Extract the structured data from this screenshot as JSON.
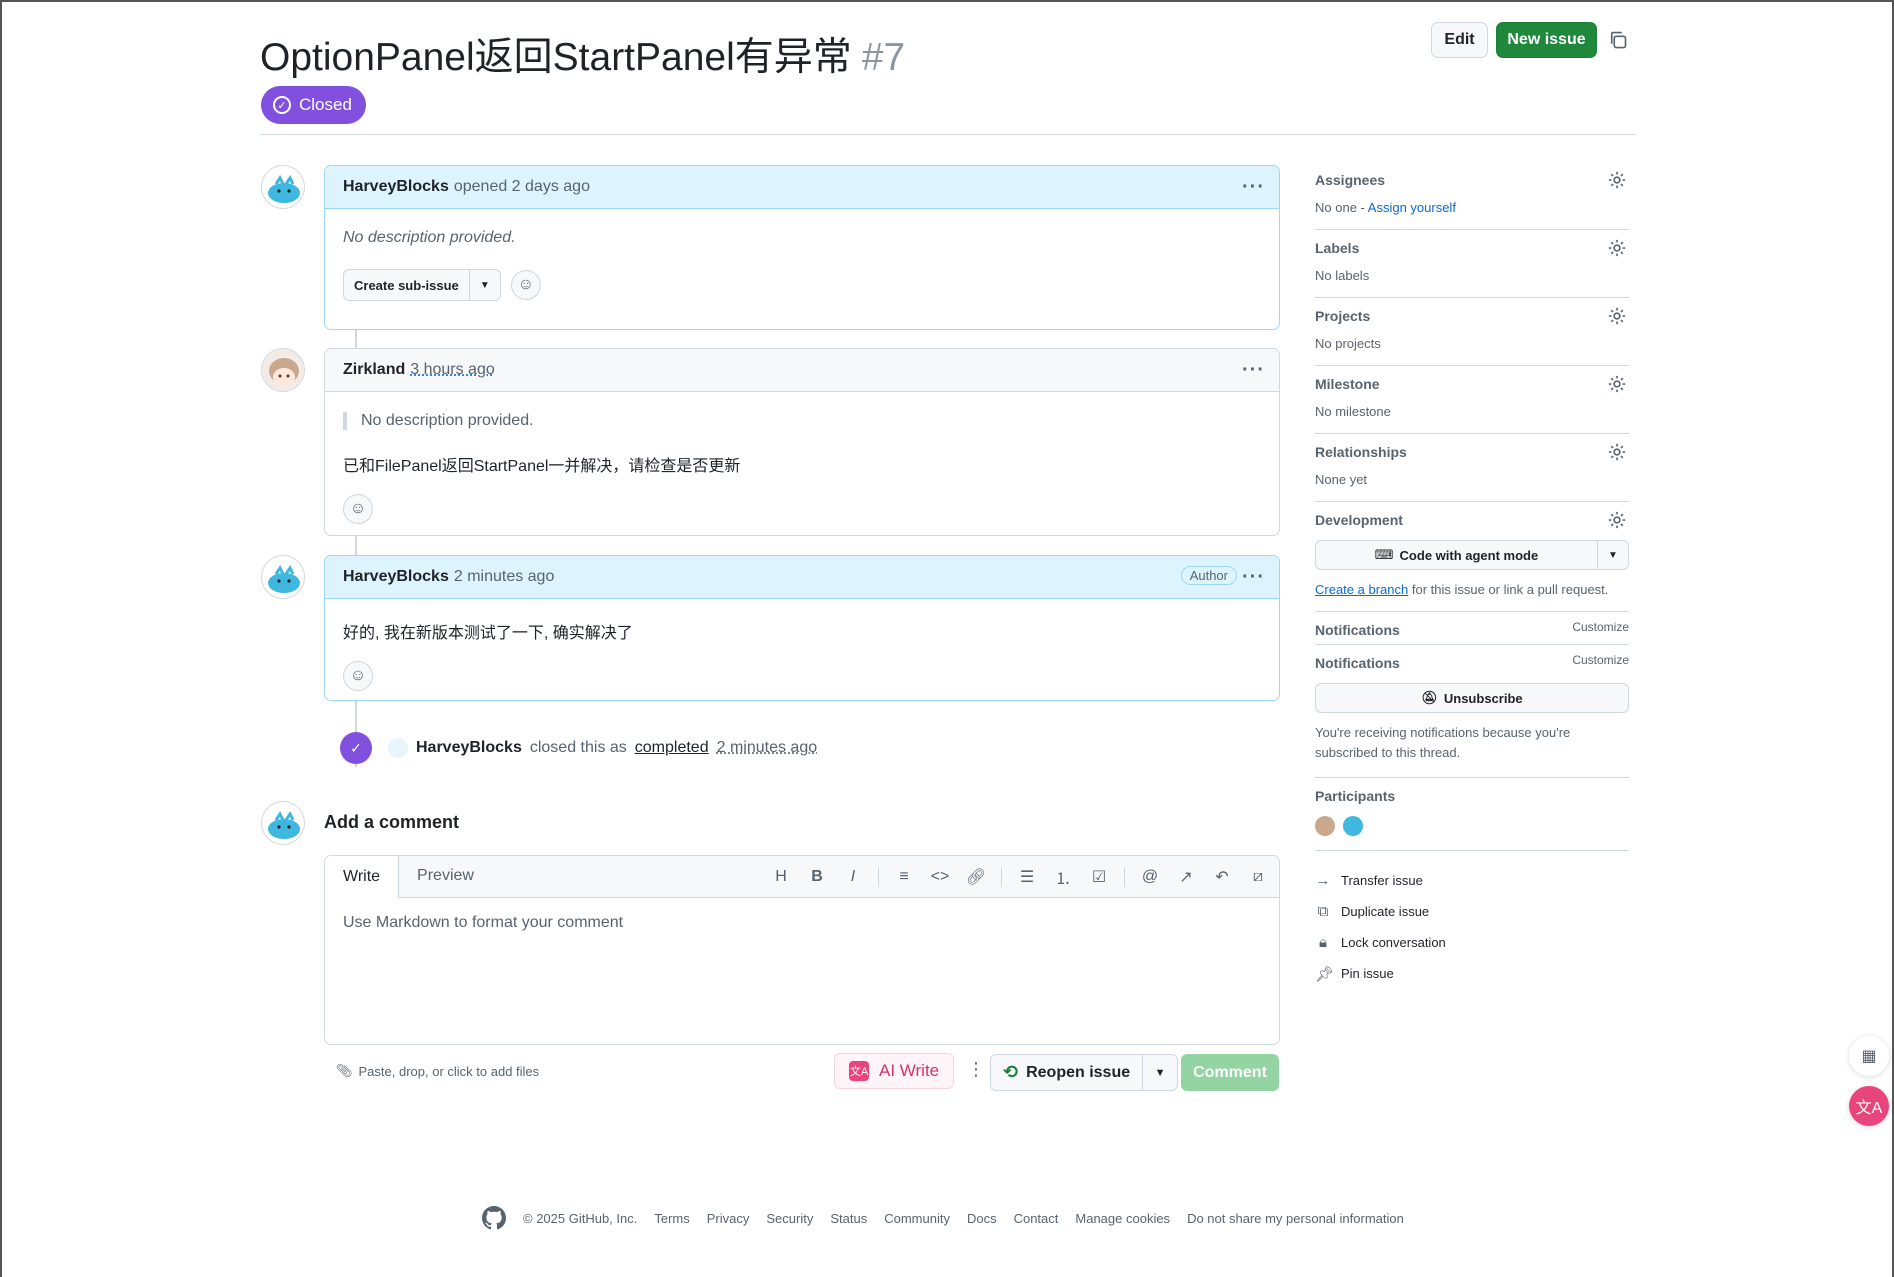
{
  "issue": {
    "title": "OptionPanel返回StartPanel有异常",
    "number": "#7",
    "state": "Closed"
  },
  "header": {
    "edit_label": "Edit",
    "new_issue_label": "New issue"
  },
  "comments": [
    {
      "author": "HarveyBlocks",
      "meta": "opened 2 days ago",
      "body": "No description provided.",
      "sub_issue_label": "Create sub-issue"
    },
    {
      "author": "Zirkland",
      "meta": "3 hours ago",
      "quote": "No description provided.",
      "body": "已和FilePanel返回StartPanel一并解决，请检查是否更新"
    },
    {
      "author": "HarveyBlocks",
      "meta": "2 minutes ago",
      "badge": "Author",
      "body": "好的, 我在新版本测试了一下, 确实解决了"
    }
  ],
  "event": {
    "actor": "HarveyBlocks",
    "text": "closed this as",
    "reason": "completed",
    "time": "2 minutes ago"
  },
  "composer": {
    "title": "Add a comment",
    "tab_write": "Write",
    "tab_preview": "Preview",
    "placeholder": "Use Markdown to format your comment",
    "paste_hint": "Paste, drop, or click to add files",
    "ai_write": "AI Write",
    "reopen_label": "Reopen issue",
    "comment_label": "Comment"
  },
  "sidebar": {
    "assignees": {
      "title": "Assignees",
      "value": "No one -",
      "link": "Assign yourself"
    },
    "labels": {
      "title": "Labels",
      "value": "No labels"
    },
    "projects": {
      "title": "Projects",
      "value": "No projects"
    },
    "milestone": {
      "title": "Milestone",
      "value": "No milestone"
    },
    "relationships": {
      "title": "Relationships",
      "value": "None yet"
    },
    "development": {
      "title": "Development",
      "agent_button": "Code with agent mode",
      "note_link": "Create a branch",
      "note_text": "for this issue or link a pull request."
    },
    "notifications1": {
      "title": "Notifications",
      "customize": "Customize"
    },
    "notifications2": {
      "title": "Notifications",
      "customize": "Customize",
      "unsubscribe": "Unsubscribe",
      "note": "You're receiving notifications because you're subscribed to this thread."
    },
    "participants": {
      "title": "Participants"
    },
    "actions": [
      "Transfer issue",
      "Duplicate issue",
      "Lock conversation",
      "Pin issue"
    ]
  },
  "footer": {
    "copyright": "© 2025 GitHub, Inc.",
    "links": [
      "Terms",
      "Privacy",
      "Security",
      "Status",
      "Community",
      "Docs",
      "Contact",
      "Manage cookies",
      "Do not share my personal information"
    ]
  },
  "colors": {
    "closed_purple": "#8250df",
    "primary_green": "#1f883d",
    "author_blue": "#ddf4ff",
    "link_blue": "#0969da"
  }
}
